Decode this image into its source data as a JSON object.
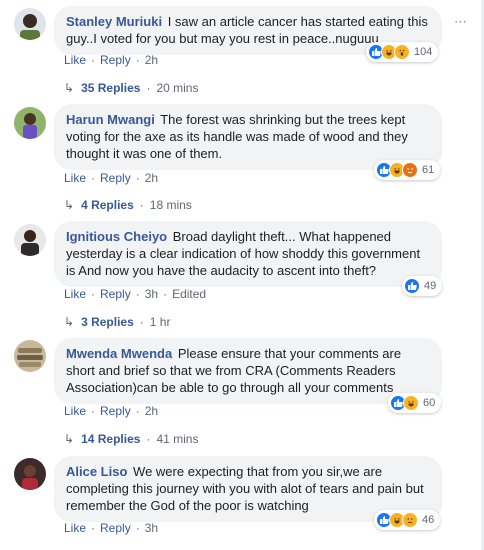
{
  "actions": {
    "like": "Like",
    "reply": "Reply",
    "separator": "·"
  },
  "more_icon": "more-horizontal-icon",
  "comments": [
    {
      "author": "Stanley Muriuki",
      "text": "I saw an article cancer has started eating this guy..I voted for you but may you rest in peace..nuguuu",
      "time": "2h",
      "edited": "",
      "reaction_icons": [
        "like-icon",
        "haha-icon",
        "wow-icon"
      ],
      "reaction_count": "104",
      "replies": "35 Replies",
      "reply_time": "20 mins"
    },
    {
      "author": "Harun Mwangi",
      "text": "The forest was shrinking but the trees kept voting for the axe as its handle was made of wood and they thought it was one of them.",
      "time": "2h",
      "edited": "",
      "reaction_icons": [
        "like-icon",
        "haha-icon",
        "angry-icon"
      ],
      "reaction_count": "61",
      "replies": "4 Replies",
      "reply_time": "18 mins"
    },
    {
      "author": "Ignitious Cheiyo",
      "text": "Broad daylight theft... What happened yesterday is a clear indication of how shoddy this government is And now you have the audacity to ascent into theft?",
      "time": "3h",
      "edited": "Edited",
      "reaction_icons": [
        "like-icon"
      ],
      "reaction_count": "49",
      "replies": "3 Replies",
      "reply_time": "1 hr"
    },
    {
      "author": "Mwenda Mwenda",
      "text": "Please ensure that your comments are short and brief so that we from CRA (Comments Readers Association)can be able to go through all your comments",
      "time": "2h",
      "edited": "",
      "reaction_icons": [
        "like-icon",
        "haha-icon"
      ],
      "reaction_count": "60",
      "replies": "14 Replies",
      "reply_time": "41 mins"
    },
    {
      "author": "Alice Liso",
      "text": "We were expecting that from you sir,we are completing this journey with you with alot of tears and pain but remember the God of the poor is watching",
      "time": "3h",
      "edited": "",
      "reaction_icons": [
        "like-icon",
        "haha-icon",
        "sad-icon"
      ],
      "reaction_count": "46",
      "replies": "",
      "reply_time": ""
    }
  ]
}
